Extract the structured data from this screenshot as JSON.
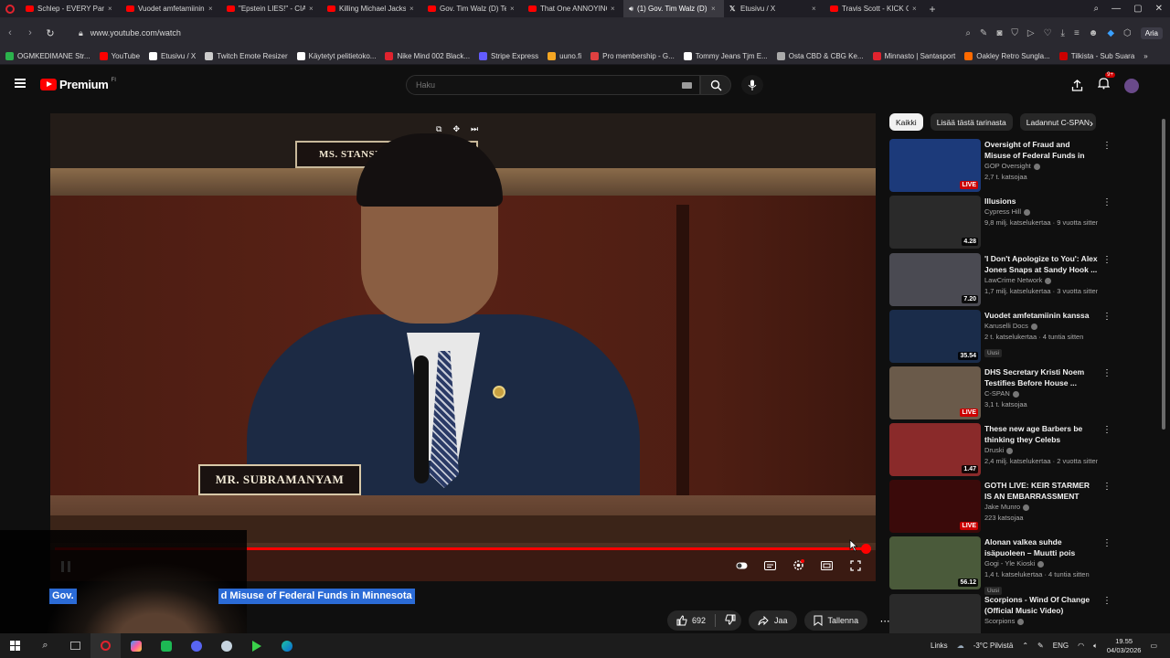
{
  "browser": {
    "tabs": [
      {
        "label": "Schlep - EVERY Parent Ne",
        "icon": "youtube"
      },
      {
        "label": "Vuodet amfetamiinin kan",
        "icon": "youtube"
      },
      {
        "label": "\"Epstein LIES!\" - CIA John",
        "icon": "youtube"
      },
      {
        "label": "Killing Michael Jackson: Th",
        "icon": "youtube"
      },
      {
        "label": "Gov. Tim Walz (D) Testifie",
        "icon": "youtube"
      },
      {
        "label": "That One ANNOYING Dru",
        "icon": "youtube"
      },
      {
        "label": "(1) Gov. Tim Walz (D)",
        "icon": "audio",
        "active": true
      },
      {
        "label": "Etusivu / X",
        "icon": "x"
      },
      {
        "label": "Travis Scott - KICK OUT -",
        "icon": "youtube"
      }
    ],
    "url": "www.youtube.com/watch",
    "aria_label": "Aria",
    "bookmarks": [
      {
        "label": "OGMKEDIMANE Str...",
        "color": "#2bb24c"
      },
      {
        "label": "YouTube",
        "color": "#ff0000"
      },
      {
        "label": "Etusivu / X",
        "color": "#ffffff"
      },
      {
        "label": "Twitch Emote Resizer",
        "color": "#cccccc"
      },
      {
        "label": "Käytetyt pelitietoko...",
        "color": "#ffffff"
      },
      {
        "label": "Nike Mind 002 Black...",
        "color": "#e0232e"
      },
      {
        "label": "Stripe Express",
        "color": "#635bff"
      },
      {
        "label": "uuno.fi",
        "color": "#f5a623"
      },
      {
        "label": "Pro membership - G...",
        "color": "#e04040"
      },
      {
        "label": "Tommy Jeans Tjm E...",
        "color": "#ffffff"
      },
      {
        "label": "Osta CBD & CBG Ke...",
        "color": "#aaaaaa"
      },
      {
        "label": "Minnasto | Santasport",
        "color": "#e0232e"
      },
      {
        "label": "Oakley Retro Sungla...",
        "color": "#ff6a00"
      },
      {
        "label": "Tilkista - Sub Suara",
        "color": "#cc0000"
      }
    ]
  },
  "youtube": {
    "logo_text": "Premium",
    "logo_superscript": "FI",
    "search_placeholder": "Haku",
    "notification_count": "9+"
  },
  "player": {
    "nameplate_top": "MS. STANSB",
    "nameplate": "MR. SUBRAMANYAM",
    "progress_fraction": 0.993
  },
  "video": {
    "title_left": "Gov.",
    "title_right": "d Misuse of Federal Funds in Minnesota",
    "likes": "692",
    "share_label": "Jaa",
    "save_label": "Tallenna"
  },
  "chips": [
    {
      "label": "Kaikki",
      "active": true
    },
    {
      "label": "Lisää tästä tarinasta",
      "active": false
    },
    {
      "label": "Ladannut C-SPAN",
      "active": false
    }
  ],
  "recommendations": [
    {
      "title": "Oversight of Fraud and Misuse of Federal Funds in Minnesota...",
      "channel": "GOP Oversight",
      "meta": "2,7 t. katsojaa",
      "duration": "LIVE",
      "live": true,
      "thumb": "#1c3a7a",
      "new": false
    },
    {
      "title": "Illusions",
      "channel": "Cypress Hill",
      "meta": "9,8 milj. katselukertaa · 9 vuotta sitten",
      "duration": "4.28",
      "live": false,
      "thumb": "#2a2a2a",
      "new": false
    },
    {
      "title": "'I Don't Apologize to You': Alex Jones Snaps at Sandy Hook ...",
      "channel": "LawCrime Network",
      "meta": "1,7 milj. katselukertaa · 3 vuotta sitten",
      "duration": "7.20",
      "live": false,
      "thumb": "#4a4a52",
      "new": false
    },
    {
      "title": "Vuodet amfetamiinin kanssa",
      "channel": "Karuselli Docs",
      "meta": "2 t. katselukertaa · 4 tuntia sitten",
      "duration": "35.54",
      "live": false,
      "thumb": "#1a2c4a",
      "new": true
    },
    {
      "title": "DHS Secretary Kristi Noem Testifies Before House ...",
      "channel": "C-SPAN",
      "meta": "3,1 t. katsojaa",
      "duration": "LIVE",
      "live": true,
      "thumb": "#6a5a4a",
      "new": false
    },
    {
      "title": "These new age Barbers be thinking they Celebs",
      "channel": "Druski",
      "meta": "2,4 milj. katselukertaa · 2 vuotta sitten",
      "duration": "1.47",
      "live": false,
      "thumb": "#8a2a2a",
      "new": false
    },
    {
      "title": "GOTH LIVE: KEIR STARMER IS AN EMBARRASSMENT",
      "channel": "Jake Munro",
      "meta": "223 katsojaa",
      "duration": "LIVE",
      "live": true,
      "thumb": "#3a0a0a",
      "new": false
    },
    {
      "title": "Alonan valkea suhde isäpuoleen – Muutti pois koto...",
      "channel": "Gogi - Yle Kioski",
      "meta": "1,4 t. katselukertaa · 4 tuntia sitten",
      "duration": "56.12",
      "live": false,
      "thumb": "#4a5a3a",
      "new": true
    },
    {
      "title": "Scorpions - Wind Of Change (Official Music Video)",
      "channel": "Scorpions",
      "meta": "",
      "duration": "",
      "live": false,
      "thumb": "#2a2a2a",
      "new": false
    }
  ],
  "taskbar": {
    "links_label": "Links",
    "weather": "-3°C Pilvistä",
    "lang": "ENG",
    "time": "19.55",
    "date": "04/03/2026"
  }
}
